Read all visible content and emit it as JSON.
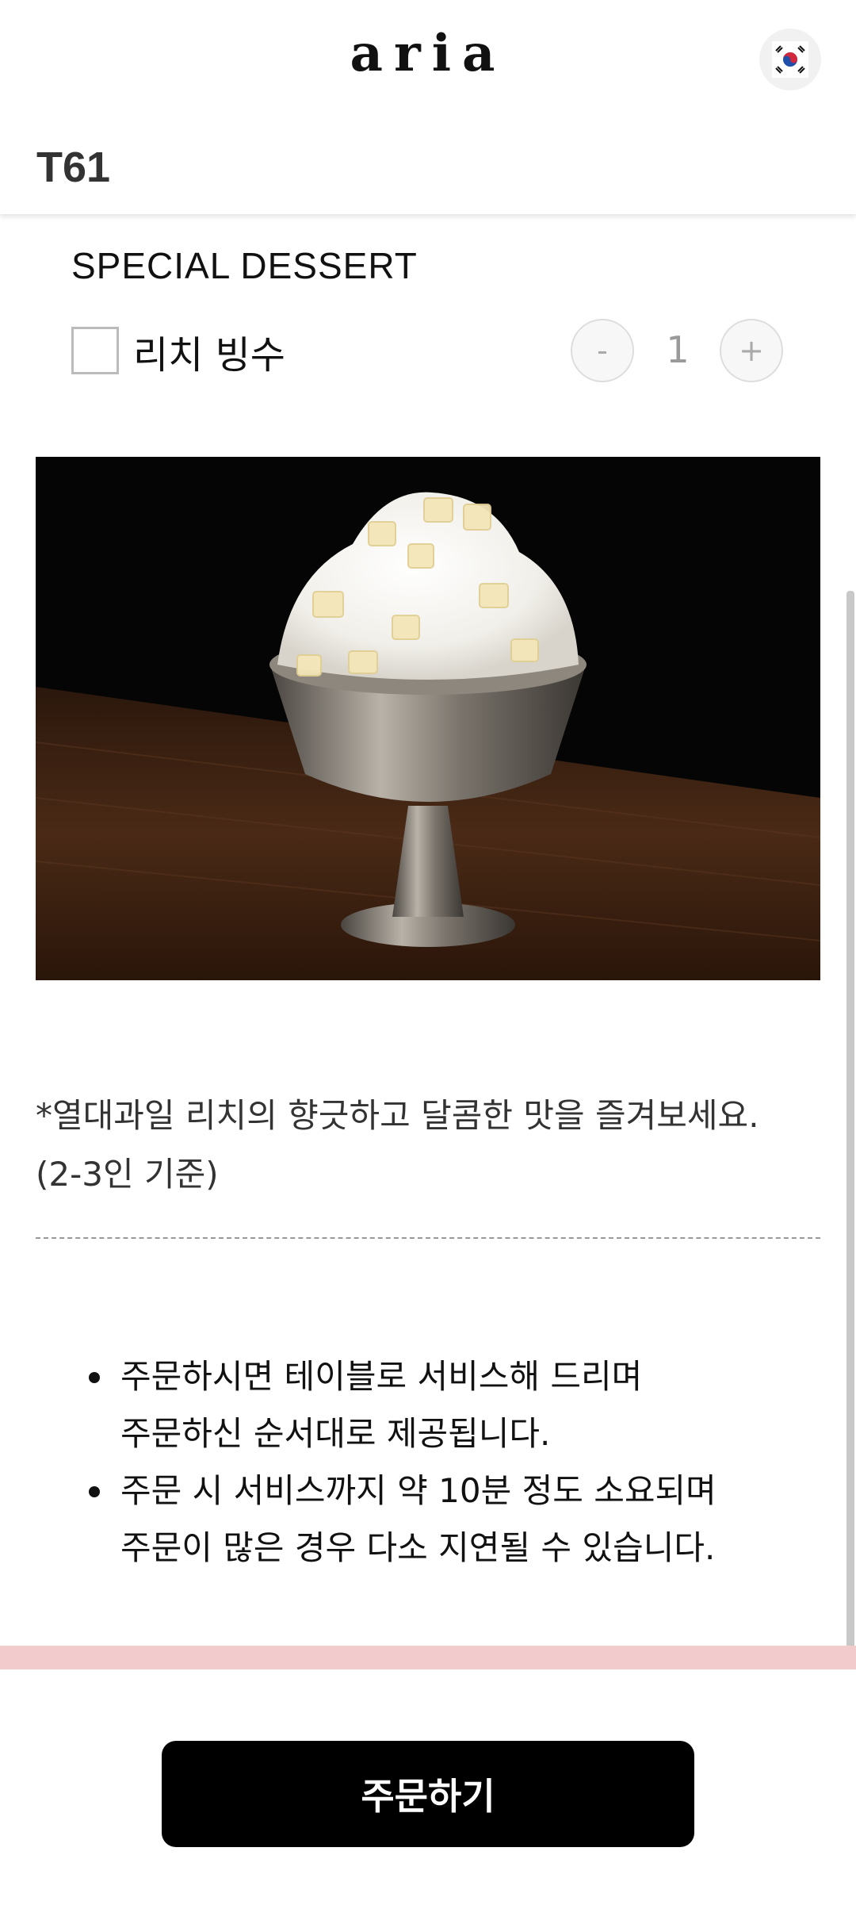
{
  "header": {
    "logo": "aria",
    "language_icon": "korea-flag-icon"
  },
  "table": {
    "id": "T61"
  },
  "menu": {
    "category": "SPECIAL DESSERT",
    "item": {
      "name": "리치 빙수",
      "checked": false,
      "quantity": "1",
      "minus_label": "-",
      "plus_label": "+"
    },
    "description_line1": "*열대과일 리치의 향긋하고 달콤한 맛을 즐겨보세요.",
    "description_line2": "(2-3인 기준)"
  },
  "notes": [
    {
      "line1": "주문하시면 테이블로 서비스해 드리며",
      "line2": "주문하신 순서대로 제공됩니다."
    },
    {
      "line1": "주문 시 서비스까지 약 10분 정도 소요되며",
      "line2": "주문이 많은 경우 다소 지연될 수 있습니다."
    }
  ],
  "footer": {
    "order_label": "주문하기"
  },
  "colors": {
    "accent_band": "#f2cccc",
    "button_bg": "#000000"
  }
}
